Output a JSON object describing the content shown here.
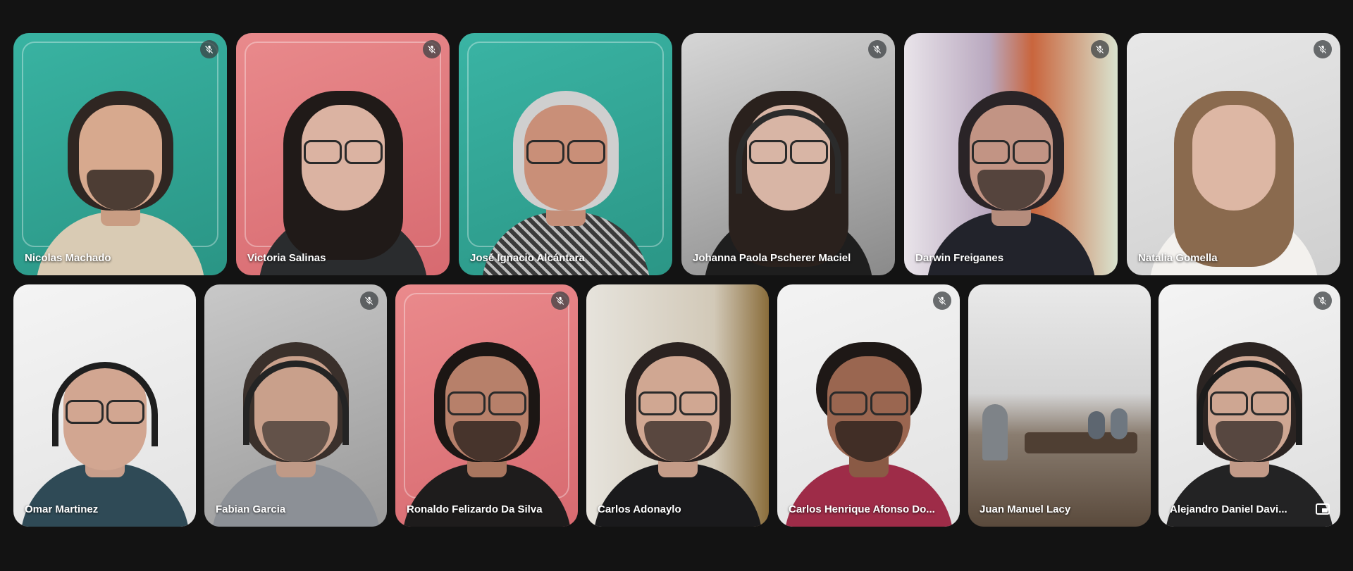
{
  "participants_row1": [
    {
      "name": "Nicolas Machado",
      "muted": true
    },
    {
      "name": "Victoria Salinas",
      "muted": true
    },
    {
      "name": "José Ignacio Alcántara",
      "muted": false
    },
    {
      "name": "Johanna Paola Pscherer Maciel",
      "muted": true
    },
    {
      "name": "Darwin Freiganes",
      "muted": true
    },
    {
      "name": "Natalia Gomella",
      "muted": true
    }
  ],
  "participants_row2": [
    {
      "name": "Omar Martinez",
      "muted": false
    },
    {
      "name": "Fabian Garcia",
      "muted": true
    },
    {
      "name": "Ronaldo Felizardo Da Silva",
      "muted": true
    },
    {
      "name": "Carlos Adonaylo",
      "muted": false
    },
    {
      "name": "Carlos Henrique Afonso Do...",
      "muted": true
    },
    {
      "name": "Juan Manuel Lacy",
      "muted": false
    },
    {
      "name": "Alejandro Daniel Davi...",
      "muted": true
    }
  ],
  "icons": {
    "mic_off": "mic-off-icon",
    "pip": "picture-in-picture-icon"
  },
  "colors": {
    "background": "#131313",
    "teal": "#2fa595",
    "pink": "#e07a7e",
    "label": "#ffffff"
  }
}
